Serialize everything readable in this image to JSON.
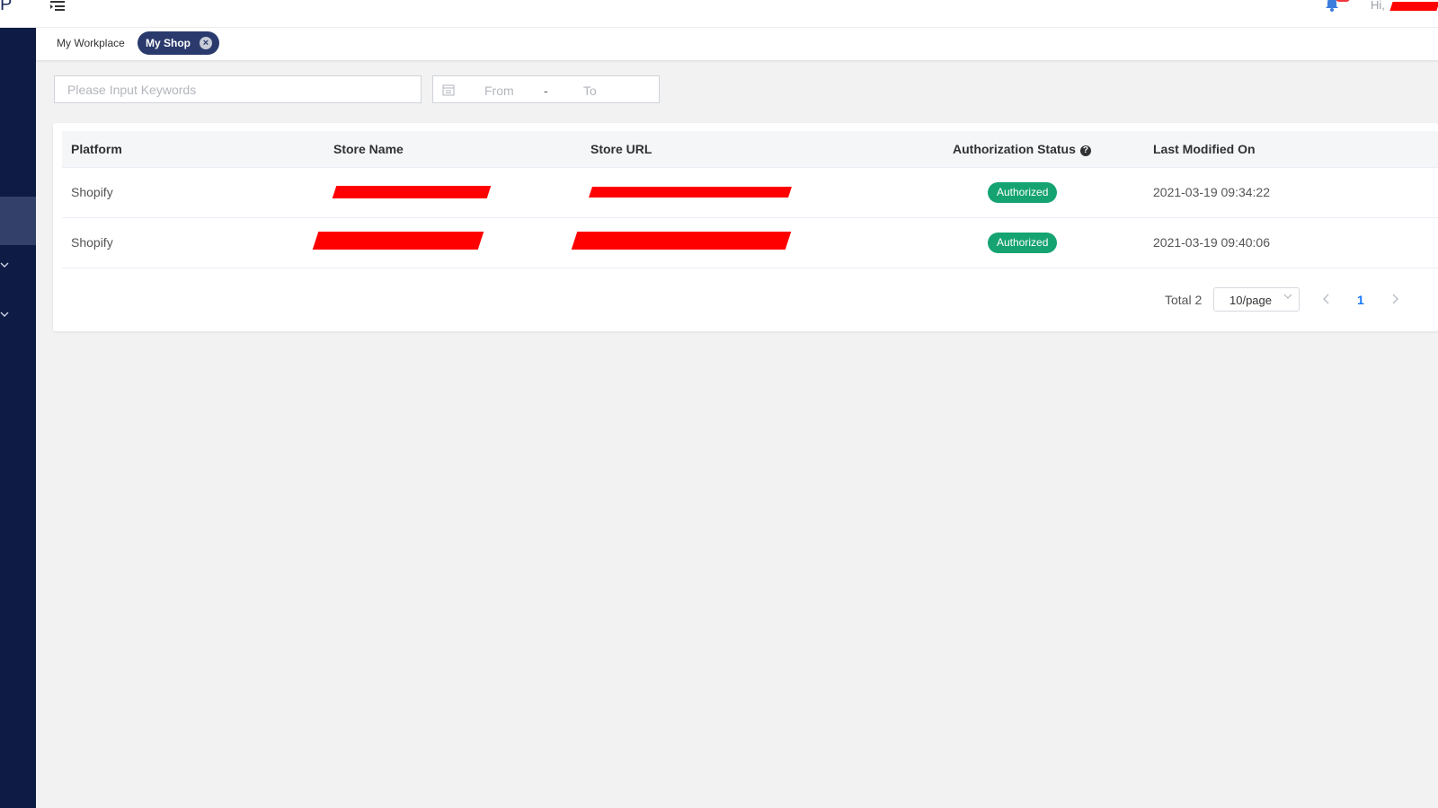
{
  "header": {
    "logo_fragment": "P",
    "greeting": "Hi,"
  },
  "tabs": [
    {
      "label": "My Workplace"
    },
    {
      "label": "My Shop",
      "close": "×"
    }
  ],
  "filters": {
    "search_placeholder": "Please Input Keywords",
    "date_from_placeholder": "From",
    "date_separator": "-",
    "date_to_placeholder": "To"
  },
  "table": {
    "columns": [
      "Platform",
      "Store Name",
      "Store URL",
      "Authorization Status",
      "Last Modified On"
    ],
    "help_glyph": "?",
    "rows": [
      {
        "platform": "Shopify",
        "status": "Authorized",
        "last_modified": "2021-03-19 09:34:22"
      },
      {
        "platform": "Shopify",
        "status": "Authorized",
        "last_modified": "2021-03-19 09:40:06"
      }
    ]
  },
  "pagination": {
    "total": "Total 2",
    "page_size": "10/page",
    "current_page": "1"
  },
  "colors": {
    "sidebar": "#0e1b44",
    "active_tab": "#2a3a6d",
    "badge_green": "#15a372",
    "redaction": "#ff0000",
    "link_blue": "#1677ff"
  },
  "icons": [
    "menu-toggle-icon",
    "bell-icon",
    "calendar-icon",
    "help-icon",
    "chevron-down-icon",
    "chevron-left-icon",
    "chevron-right-icon",
    "close-icon"
  ]
}
